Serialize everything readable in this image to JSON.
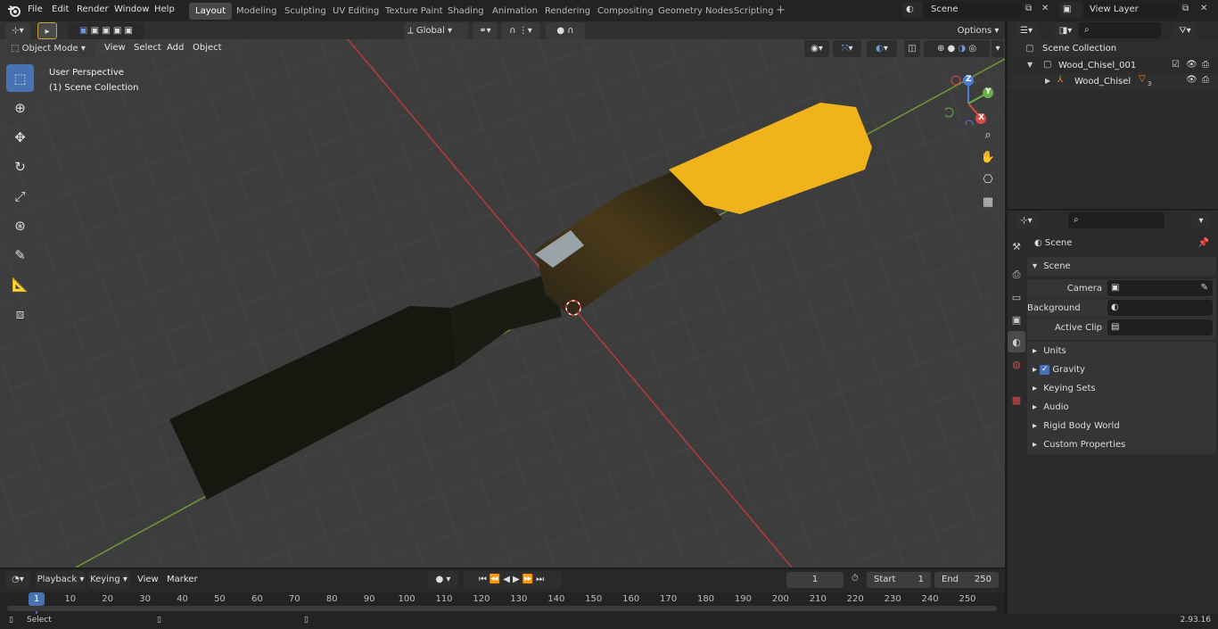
{
  "menu": {
    "items": [
      "File",
      "Edit",
      "Render",
      "Window",
      "Help"
    ]
  },
  "workspaces": [
    {
      "label": "Layout",
      "active": true
    },
    {
      "label": "Modeling"
    },
    {
      "label": "Sculpting"
    },
    {
      "label": "UV Editing"
    },
    {
      "label": "Texture Paint"
    },
    {
      "label": "Shading"
    },
    {
      "label": "Animation"
    },
    {
      "label": "Rendering"
    },
    {
      "label": "Compositing"
    },
    {
      "label": "Geometry Nodes"
    },
    {
      "label": "Scripting"
    }
  ],
  "scene": {
    "name": "Scene"
  },
  "view_layer": {
    "name": "View Layer"
  },
  "viewport_header": {
    "mode": "Object Mode",
    "menus": [
      "View",
      "Select",
      "Add",
      "Object"
    ],
    "transform": "Global",
    "options": "Options"
  },
  "viewport": {
    "perspective": "User Perspective",
    "collection": "(1) Scene Collection"
  },
  "gizmo": {
    "z": "Z",
    "y": "Y",
    "x": "X"
  },
  "outliner": {
    "root": "Scene Collection",
    "collection": "Wood_Chisel_001",
    "object": "Wood_Chisel",
    "modifier_count": "3"
  },
  "properties": {
    "context": "Scene",
    "panel": "Scene",
    "camera_label": "Camera",
    "background_label": "Background Scene",
    "clip_label": "Active Clip",
    "sections": [
      "Units",
      "Gravity",
      "Keying Sets",
      "Audio",
      "Rigid Body World",
      "Custom Properties"
    ]
  },
  "timeline": {
    "menus": [
      "Playback",
      "Keying",
      "View",
      "Marker"
    ],
    "current_frame": "1",
    "start_label": "Start",
    "start": "1",
    "end_label": "End",
    "end": "250",
    "ticks": [
      "1",
      "10",
      "20",
      "30",
      "40",
      "50",
      "60",
      "70",
      "80",
      "90",
      "100",
      "110",
      "120",
      "130",
      "140",
      "150",
      "160",
      "170",
      "180",
      "190",
      "200",
      "210",
      "220",
      "230",
      "240",
      "250"
    ]
  },
  "status": {
    "action": "Select",
    "version": "2.93.16"
  }
}
